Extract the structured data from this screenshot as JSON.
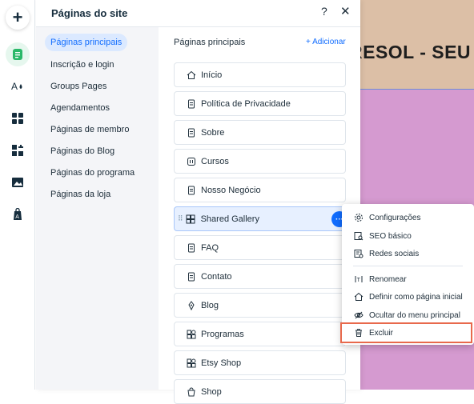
{
  "panel": {
    "title": "Páginas do site",
    "help": "?",
    "close": "✕"
  },
  "categories": [
    "Páginas principais",
    "Inscrição e login",
    "Groups Pages",
    "Agendamentos",
    "Páginas de membro",
    "Páginas do Blog",
    "Páginas do programa",
    "Páginas da loja"
  ],
  "list": {
    "title": "Páginas principais",
    "add": "+ Adicionar",
    "pages": [
      "Início",
      "Política de Privacidade",
      "Sobre",
      "Cursos",
      "Nosso Negócio",
      "Shared Gallery",
      "FAQ",
      "Contato",
      "Blog",
      "Programas",
      "Etsy Shop",
      "Shop"
    ],
    "more": "···"
  },
  "menu": {
    "items": [
      "Configurações",
      "SEO básico",
      "Redes sociais",
      "Renomear",
      "Definir como página inicial",
      "Ocultar do menu principal",
      "Excluir"
    ]
  },
  "canvas": {
    "heading": "RESOL - SEU P"
  },
  "rail": {
    "add": "+"
  },
  "colors": {
    "accent": "#116dff",
    "highlight": "#e8694c",
    "canvas_top": "#dcbfa6",
    "canvas_body": "#d59ad0"
  }
}
